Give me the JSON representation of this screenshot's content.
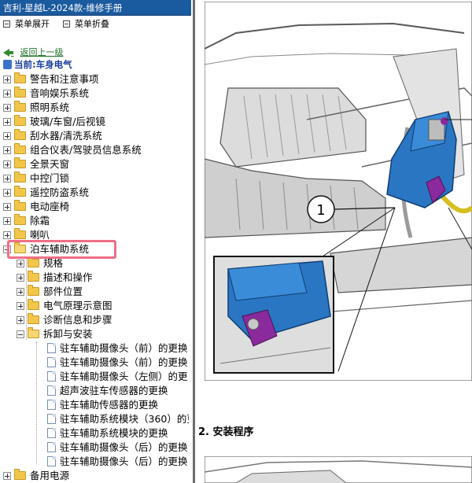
{
  "window": {
    "title": "吉利-星越L-2024款-维修手册"
  },
  "toolbar": {
    "expand_label": "菜单展开",
    "collapse_label": "菜单折叠"
  },
  "nav": {
    "back_label": "返回上一级",
    "current_label": "当前:车身电气"
  },
  "tree": {
    "top_items": [
      "警告和注意事项",
      "音响娱乐系统",
      "照明系统",
      "玻璃/车窗/后视镜",
      "刮水器/清洗系统",
      "组合仪表/驾驶员信息系统",
      "全景天窗",
      "中控门锁",
      "遥控防盗系统",
      "电动座椅",
      "除霜",
      "喇叭"
    ],
    "selected": "泊车辅助系统",
    "sub_folders": [
      "规格",
      "描述和操作",
      "部件位置",
      "电气原理示意图",
      "诊断信息和步骤"
    ],
    "open_folder": "拆卸与安装",
    "documents": [
      "驻车辅助摄像头（前）的更换",
      "驻车辅助摄像头（前）的更换",
      "驻车辅助摄像头（左侧）的更",
      "超声波驻车传感器的更换",
      "驻车辅助传感器的更换",
      "驻车辅助系统模块（360）的更",
      "驻车辅助系统模块的更换",
      "驻车辅助摄像头（后）的更换",
      "驻车辅助摄像头（后）的更换"
    ],
    "last_item": "备用电源"
  },
  "content": {
    "callout_1": "1",
    "step_heading": "2. 安装程序"
  },
  "colors": {
    "titlebar": "#1a5a9e",
    "highlight": "#ef6f86",
    "module_blue": "#2a76c2",
    "connector_purple": "#8a2a9c"
  }
}
